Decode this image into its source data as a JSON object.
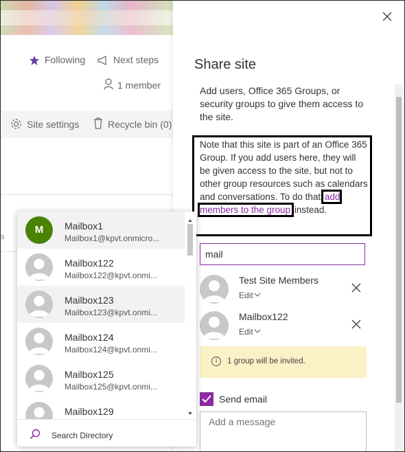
{
  "site": {
    "following_label": "Following",
    "next_steps_label": "Next steps",
    "members_label": "1 member",
    "site_settings_label": "Site settings",
    "recycle_bin_label": "Recycle bin (0)",
    "edge_fragment": "s"
  },
  "panel": {
    "title": "Share site",
    "description": "Add users, Office 365 Groups, or security groups to give them access to the site.",
    "note_before": "Note that this site is part of an Office 365 Group. If you add users here, they will be given access to the site, but not to other group resources such as calendars and conversations. To do that ",
    "note_link": "add members to the group",
    "note_after": " instead.",
    "search_value": "mail",
    "people": [
      {
        "name": "Test Site Members",
        "permission": "Edit"
      },
      {
        "name": "Mailbox122",
        "permission": "Edit"
      }
    ],
    "info_text": "1 group will be invited.",
    "send_email_label": "Send email",
    "send_email_checked": true,
    "message_placeholder": "Add a message",
    "accent_color": "#8a2ba2"
  },
  "suggestions": {
    "items": [
      {
        "name": "Mailbox1",
        "email": "Mailbox1@kpvt.onmicro...",
        "initial": "M",
        "avatar": "initial-green",
        "selected": true
      },
      {
        "name": "Mailbox122",
        "email": "Mailbox122@kpvt.onmi...",
        "avatar": "person-icon"
      },
      {
        "name": "Mailbox123",
        "email": "Mailbox123@kpvt.onmi...",
        "avatar": "person-icon",
        "selected": true
      },
      {
        "name": "Mailbox124",
        "email": "Mailbox124@kpvt.onmi...",
        "avatar": "person-icon"
      },
      {
        "name": "Mailbox125",
        "email": "Mailbox125@kpvt.onmi...",
        "avatar": "person-icon"
      },
      {
        "name": "Mailbox129",
        "email": "",
        "avatar": "person-icon"
      }
    ],
    "footer_label": "Search Directory",
    "green": "#498205"
  }
}
